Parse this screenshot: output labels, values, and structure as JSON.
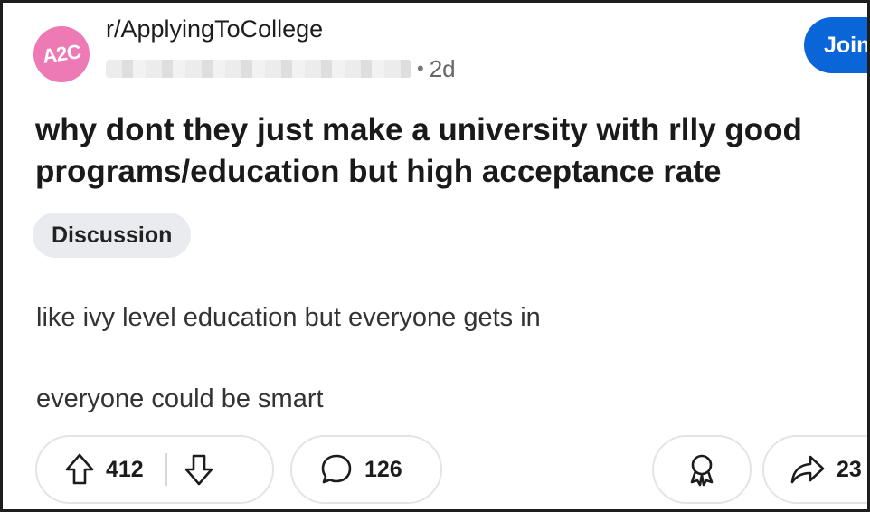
{
  "post": {
    "subreddit": "r/ApplyingToCollege",
    "avatar_text": "A2C",
    "separator": "•",
    "age": "2d",
    "join_label": "Join",
    "title": "why dont they just make a university with rlly good programs/education but high acceptance rate",
    "flair": "Discussion",
    "body": [
      "like ivy level education but everyone gets in",
      "everyone could be smart"
    ]
  },
  "actions": {
    "upvotes": "412",
    "comments": "126",
    "shares": "23"
  },
  "icons": {
    "upvote": "upvote-arrow-icon",
    "downvote": "downvote-arrow-icon",
    "comment": "speech-bubble-icon",
    "award": "award-ribbon-icon",
    "share": "share-arrow-icon"
  },
  "colors": {
    "avatar": "#ee7ab5",
    "join": "#0a66d8",
    "flair_bg": "#e9ebee"
  }
}
